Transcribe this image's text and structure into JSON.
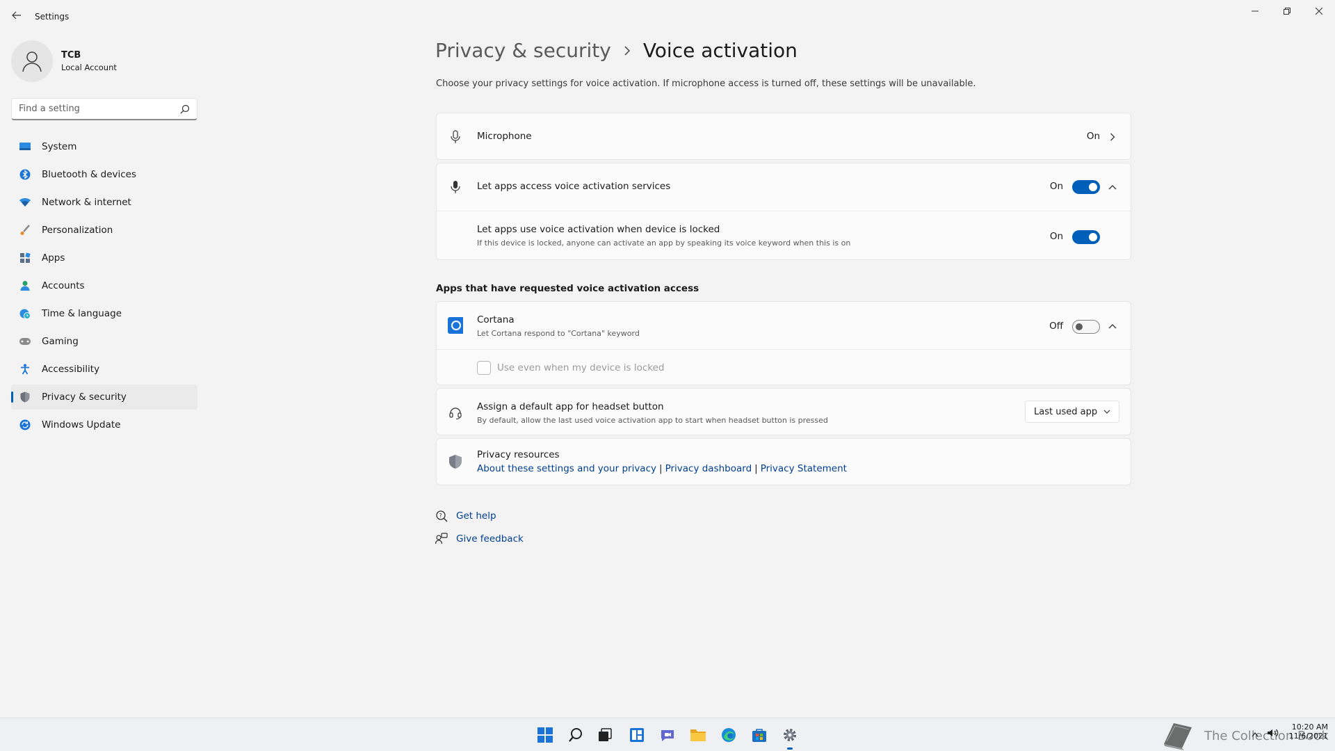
{
  "window": {
    "title": "Settings"
  },
  "user": {
    "name": "TCB",
    "account_type": "Local Account"
  },
  "search": {
    "placeholder": "Find a setting"
  },
  "sidebar": {
    "items": [
      {
        "label": "System",
        "icon": "monitor-icon"
      },
      {
        "label": "Bluetooth & devices",
        "icon": "bluetooth-icon"
      },
      {
        "label": "Network & internet",
        "icon": "wifi-icon"
      },
      {
        "label": "Personalization",
        "icon": "brush-icon"
      },
      {
        "label": "Apps",
        "icon": "apps-icon"
      },
      {
        "label": "Accounts",
        "icon": "person-icon"
      },
      {
        "label": "Time & language",
        "icon": "globe-clock-icon"
      },
      {
        "label": "Gaming",
        "icon": "gamepad-icon"
      },
      {
        "label": "Accessibility",
        "icon": "accessibility-icon"
      },
      {
        "label": "Privacy & security",
        "icon": "shield-icon",
        "active": true
      },
      {
        "label": "Windows Update",
        "icon": "update-icon"
      }
    ]
  },
  "header": {
    "parent": "Privacy & security",
    "current": "Voice activation",
    "description": "Choose your privacy settings for voice activation. If microphone access is turned off, these settings will be unavailable."
  },
  "microphone": {
    "label": "Microphone",
    "state": "On"
  },
  "voice_access": {
    "label": "Let apps access voice activation services",
    "state": "On",
    "locked": {
      "label": "Let apps use voice activation when device is locked",
      "sub": "If this device is locked, anyone can activate an app by speaking its voice keyword when this is on",
      "state": "On"
    }
  },
  "apps_section": {
    "title": "Apps that have requested voice activation access",
    "cortana": {
      "label": "Cortana",
      "sub": "Let Cortana respond to \"Cortana\" keyword",
      "state": "Off",
      "checkbox_label": "Use even when my device is locked"
    }
  },
  "headset": {
    "label": "Assign a default app for headset button",
    "sub": "By default, allow the last used voice activation app to start when headset button is pressed",
    "dropdown_value": "Last used app"
  },
  "privacy_resources": {
    "title": "Privacy resources",
    "links": [
      "About these settings and your privacy",
      "Privacy dashboard",
      "Privacy Statement"
    ]
  },
  "help": {
    "get_help": "Get help",
    "give_feedback": "Give feedback"
  },
  "taskbar": {
    "time": "10:20 AM",
    "date": "11/6/2021",
    "watermark": "The Collection Book"
  },
  "colors": {
    "accent": "#005fb8",
    "link": "#003e92",
    "background": "#f3f3f3"
  }
}
